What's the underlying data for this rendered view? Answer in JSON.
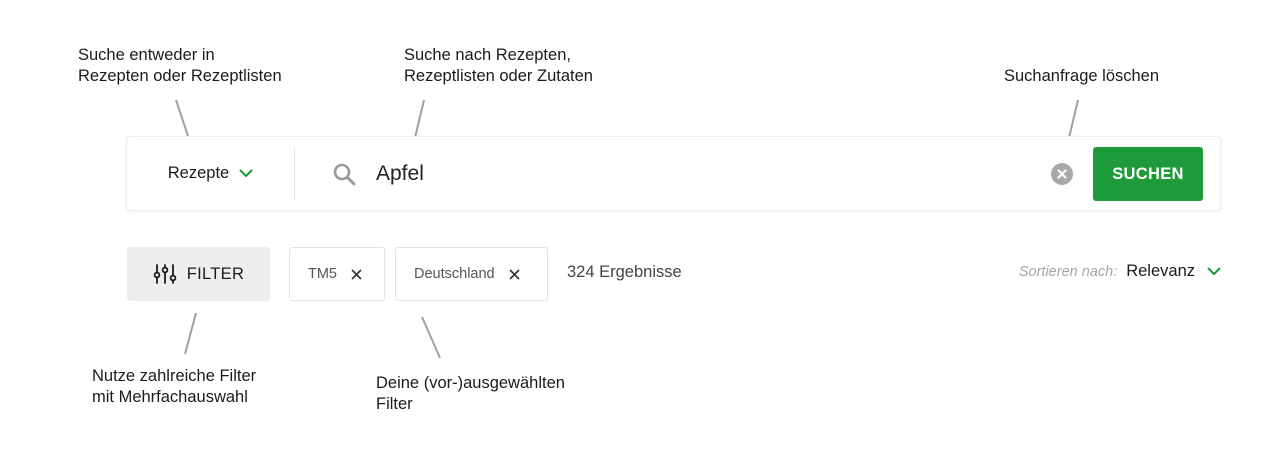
{
  "annotations": {
    "type_select": [
      "Suche entweder in",
      "Rezepten oder Rezeptlisten"
    ],
    "search_query": [
      "Suche nach Rezepten,",
      "Rezeptlisten oder Zutaten"
    ],
    "clear": [
      "Suchanfrage löschen"
    ],
    "filter": [
      "Nutze zahlreiche Filter",
      "mit Mehrfachauswahl"
    ],
    "chips": [
      "Deine (vor-)ausgewählten",
      "Filter"
    ]
  },
  "search": {
    "type_label": "Rezepte",
    "query_value": "Apfel",
    "submit_label": "SUCHEN"
  },
  "filters": {
    "button_label": "FILTER",
    "chips": [
      {
        "label": "TM5"
      },
      {
        "label": "Deutschland"
      }
    ],
    "result_count": "324 Ergebnisse"
  },
  "sort": {
    "label": "Sortieren nach:",
    "value": "Relevanz"
  },
  "colors": {
    "accent": "#1e9a3a",
    "annotation_line": "#a0a0a0"
  },
  "icons": {
    "type_dropdown": "chevron-down-icon",
    "search": "search-icon",
    "clear": "clear-circle-icon",
    "filter": "sliders-icon",
    "chip_remove": "close-icon",
    "sort_dropdown": "chevron-down-icon"
  }
}
